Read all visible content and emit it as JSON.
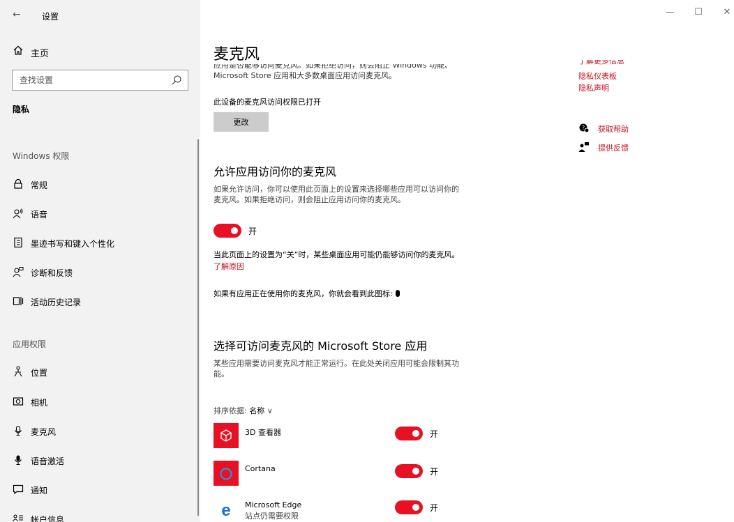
{
  "window": {
    "title": "设置",
    "back_glyph": "←",
    "controls": {
      "minimize": "—",
      "maximize": "☐",
      "close": "✕"
    }
  },
  "sidebar": {
    "home_label": "主页",
    "search_placeholder": "查找设置",
    "current_section": "隐私",
    "groups": [
      {
        "label": "Windows 权限"
      },
      {
        "label": "应用权限"
      }
    ],
    "windows_items": [
      {
        "label": "常规",
        "icon": "lock-icon"
      },
      {
        "label": "语音",
        "icon": "speech-icon"
      },
      {
        "label": "墨迹书写和键入个性化",
        "icon": "notebook-icon"
      },
      {
        "label": "诊断和反馈",
        "icon": "feedback-person-icon"
      },
      {
        "label": "活动历史记录",
        "icon": "timeline-icon"
      }
    ],
    "app_items": [
      {
        "label": "位置",
        "icon": "location-person-icon"
      },
      {
        "label": "相机",
        "icon": "camera-icon"
      },
      {
        "label": "麦克风",
        "icon": "microphone-icon"
      },
      {
        "label": "语音激活",
        "icon": "microphone-filled-icon"
      },
      {
        "label": "通知",
        "icon": "notification-icon"
      },
      {
        "label": "帐户信息",
        "icon": "account-info-icon"
      }
    ]
  },
  "main": {
    "title": "麦克风",
    "clipped_line1": "应用是否能够访问麦克风。如果拒绝访问，则会阻止 Windows 功能、",
    "clipped_line2": "Microsoft Store 应用和大多数桌面应用访问麦克风。",
    "device_status": "此设备的麦克风访问权限已打开",
    "change_button": "更改",
    "allow_heading": "允许应用访问你的麦克风",
    "allow_desc_1": "如果允许访问，你可以使用此页面上的设置来选择哪些应用可以访问你的",
    "allow_desc_2": "麦克风。如果拒绝访问，则会阻止应用访问你的麦克风。",
    "allow_toggle": {
      "state": "开",
      "on": true
    },
    "note": "当此页面上的设置为“关”时，某些桌面应用可能仍能够访问你的麦克风。",
    "learn_why": "了解原因",
    "icon_note": "如果有应用正在使用你的麦克风，你就会看到此图标:",
    "choose_heading": "选择可访问麦克风的 Microsoft Store 应用",
    "choose_desc_1": "某些应用需要访问麦克风才能正常运行。在此处关闭应用可能会限制其功",
    "choose_desc_2": "能。",
    "sort_label": "排序依据:",
    "sort_value": "名称",
    "sort_chevron": "∨",
    "apps": [
      {
        "name": "3D 查看器",
        "sub": "",
        "state": "开",
        "on": true,
        "icon": "3d-viewer-icon",
        "color": "#e81123"
      },
      {
        "name": "Cortana",
        "sub": "",
        "state": "开",
        "on": true,
        "icon": "cortana-icon",
        "color": "#e81123"
      },
      {
        "name": "Microsoft Edge",
        "sub": "站点仍需要权限",
        "state": "开",
        "on": true,
        "icon": "edge-icon",
        "color": "#ffffff"
      }
    ]
  },
  "right": {
    "clipped_link": "了解更多信息",
    "privacy_dashboard": "隐私仪表板",
    "privacy_statement": "隐私声明",
    "get_help": "获取帮助",
    "give_feedback": "提供反馈"
  },
  "colors": {
    "accent": "#e81123",
    "link": "#c50f1f",
    "sidebar_bg": "#f2f2f2",
    "button_bg": "#cccccc"
  }
}
